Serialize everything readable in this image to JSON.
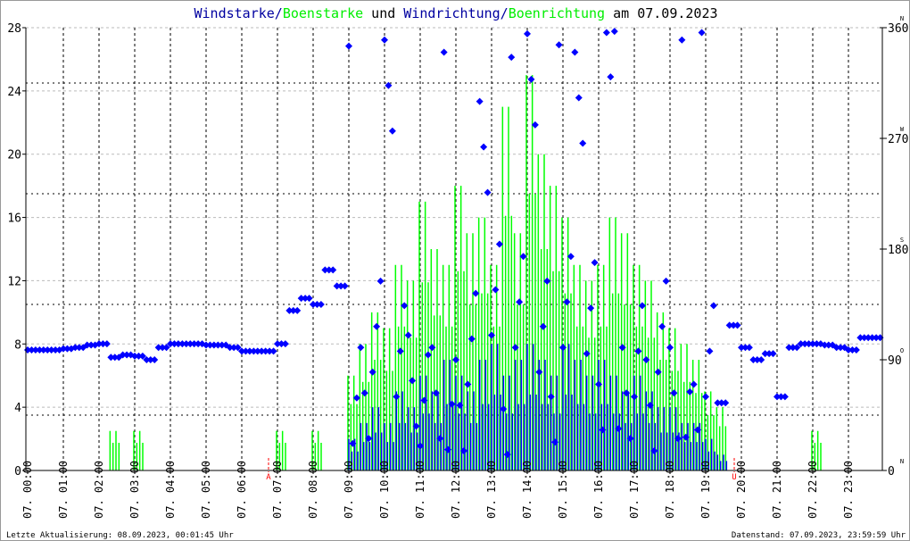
{
  "chart_data": {
    "type": "bar",
    "title_parts": [
      {
        "text": "Windstarke",
        "color": "#0000a0"
      },
      {
        "text": "/",
        "color": "#0000a0"
      },
      {
        "text": "Boenstarke",
        "color": "#00ee00"
      },
      {
        "text": " und ",
        "color": "#000000"
      },
      {
        "text": "Windrichtung",
        "color": "#0000a0"
      },
      {
        "text": "/",
        "color": "#0000a0"
      },
      {
        "text": "Boenrichtung",
        "color": "#00ee00"
      },
      {
        "text": " am 07.09.2023",
        "color": "#000000"
      }
    ],
    "x_interval_minutes": 20,
    "x_ticks": [
      "07. 00:00",
      "07. 01:00",
      "07. 02:00",
      "07. 03:00",
      "07. 04:00",
      "07. 05:00",
      "07. 06:00",
      "07. 07:00",
      "07. 08:00",
      "07. 09:00",
      "07. 10:00",
      "07. 11:00",
      "07. 12:00",
      "07. 13:00",
      "07. 14:00",
      "07. 15:00",
      "07. 16:00",
      "07. 17:00",
      "07. 18:00",
      "07. 19:00",
      "07. 20:00",
      "07. 21:00",
      "07. 22:00",
      "07. 23:00"
    ],
    "y_left": {
      "ticks": [
        0,
        4,
        8,
        12,
        16,
        20,
        24,
        28
      ],
      "ylim": [
        0,
        28
      ]
    },
    "y_right": {
      "ticks": [
        {
          "v": 0,
          "d": "N"
        },
        {
          "v": 90,
          "d": "O"
        },
        {
          "v": 180,
          "d": "S"
        },
        {
          "v": 270,
          "d": "W"
        },
        {
          "v": 360,
          "d": "N"
        }
      ],
      "ylim": [
        0,
        360
      ]
    },
    "markers": [
      {
        "label": "A",
        "hour": 6.8
      },
      {
        "label": "U",
        "hour": 19.85
      }
    ],
    "series": [
      {
        "name": "Windstarke",
        "color": "#0000ff",
        "values": [
          0,
          0,
          0,
          0,
          0,
          0,
          0,
          0,
          0,
          0,
          0,
          0,
          0,
          0,
          0,
          0,
          0,
          0,
          0,
          0,
          0,
          0,
          0,
          0,
          0,
          0,
          0,
          2,
          3,
          4,
          3,
          5,
          4,
          6,
          5,
          7,
          6,
          5,
          7,
          8,
          6,
          7,
          8,
          7,
          6,
          8,
          7,
          6,
          7,
          6,
          5,
          6,
          5,
          4,
          4,
          3,
          3,
          2,
          1,
          0,
          0,
          0,
          0,
          0,
          0,
          0,
          0,
          0,
          0,
          0,
          0,
          0
        ]
      },
      {
        "name": "Boenstarke",
        "color": "#00ff00",
        "values": [
          0,
          0,
          0,
          0,
          0,
          0,
          0,
          2.5,
          0,
          2.5,
          0,
          0,
          0,
          0,
          0,
          0,
          0,
          0,
          0,
          0,
          0,
          2.5,
          0,
          0,
          2.5,
          0,
          0,
          6,
          8,
          10,
          9,
          13,
          12,
          17,
          14,
          13,
          18,
          15,
          16,
          13,
          23,
          15,
          25,
          20,
          18,
          16,
          13,
          12,
          13,
          16,
          15,
          13,
          12,
          10,
          9,
          8,
          7,
          5,
          4,
          0,
          0,
          0,
          0,
          0,
          0,
          0,
          2.5,
          0,
          0,
          0,
          0,
          0
        ]
      },
      {
        "name": "Windrichtung",
        "color": "#0000ff",
        "unit": "deg",
        "values": [
          98,
          98,
          98,
          99,
          100,
          102,
          103,
          92,
          94,
          93,
          90,
          100,
          103,
          103,
          103,
          102,
          102,
          100,
          97,
          97,
          97,
          103,
          130,
          140,
          135,
          163,
          150,
          345,
          100,
          80,
          350,
          60,
          110,
          20,
          100,
          340,
          90,
          70,
          300,
          110,
          50,
          100,
          355,
          80,
          60,
          100,
          340,
          95,
          70,
          320,
          100,
          60,
          90,
          80,
          100,
          350,
          70,
          60,
          55,
          118,
          100,
          90,
          95,
          60,
          100,
          103,
          103,
          102,
          100,
          98,
          108,
          108
        ]
      }
    ]
  },
  "footer": {
    "left": "Letzte Aktualisierung: 08.09.2023, 00:01:45 Uhr",
    "right": "Datenstand: 07.09.2023, 23:59:59 Uhr"
  }
}
